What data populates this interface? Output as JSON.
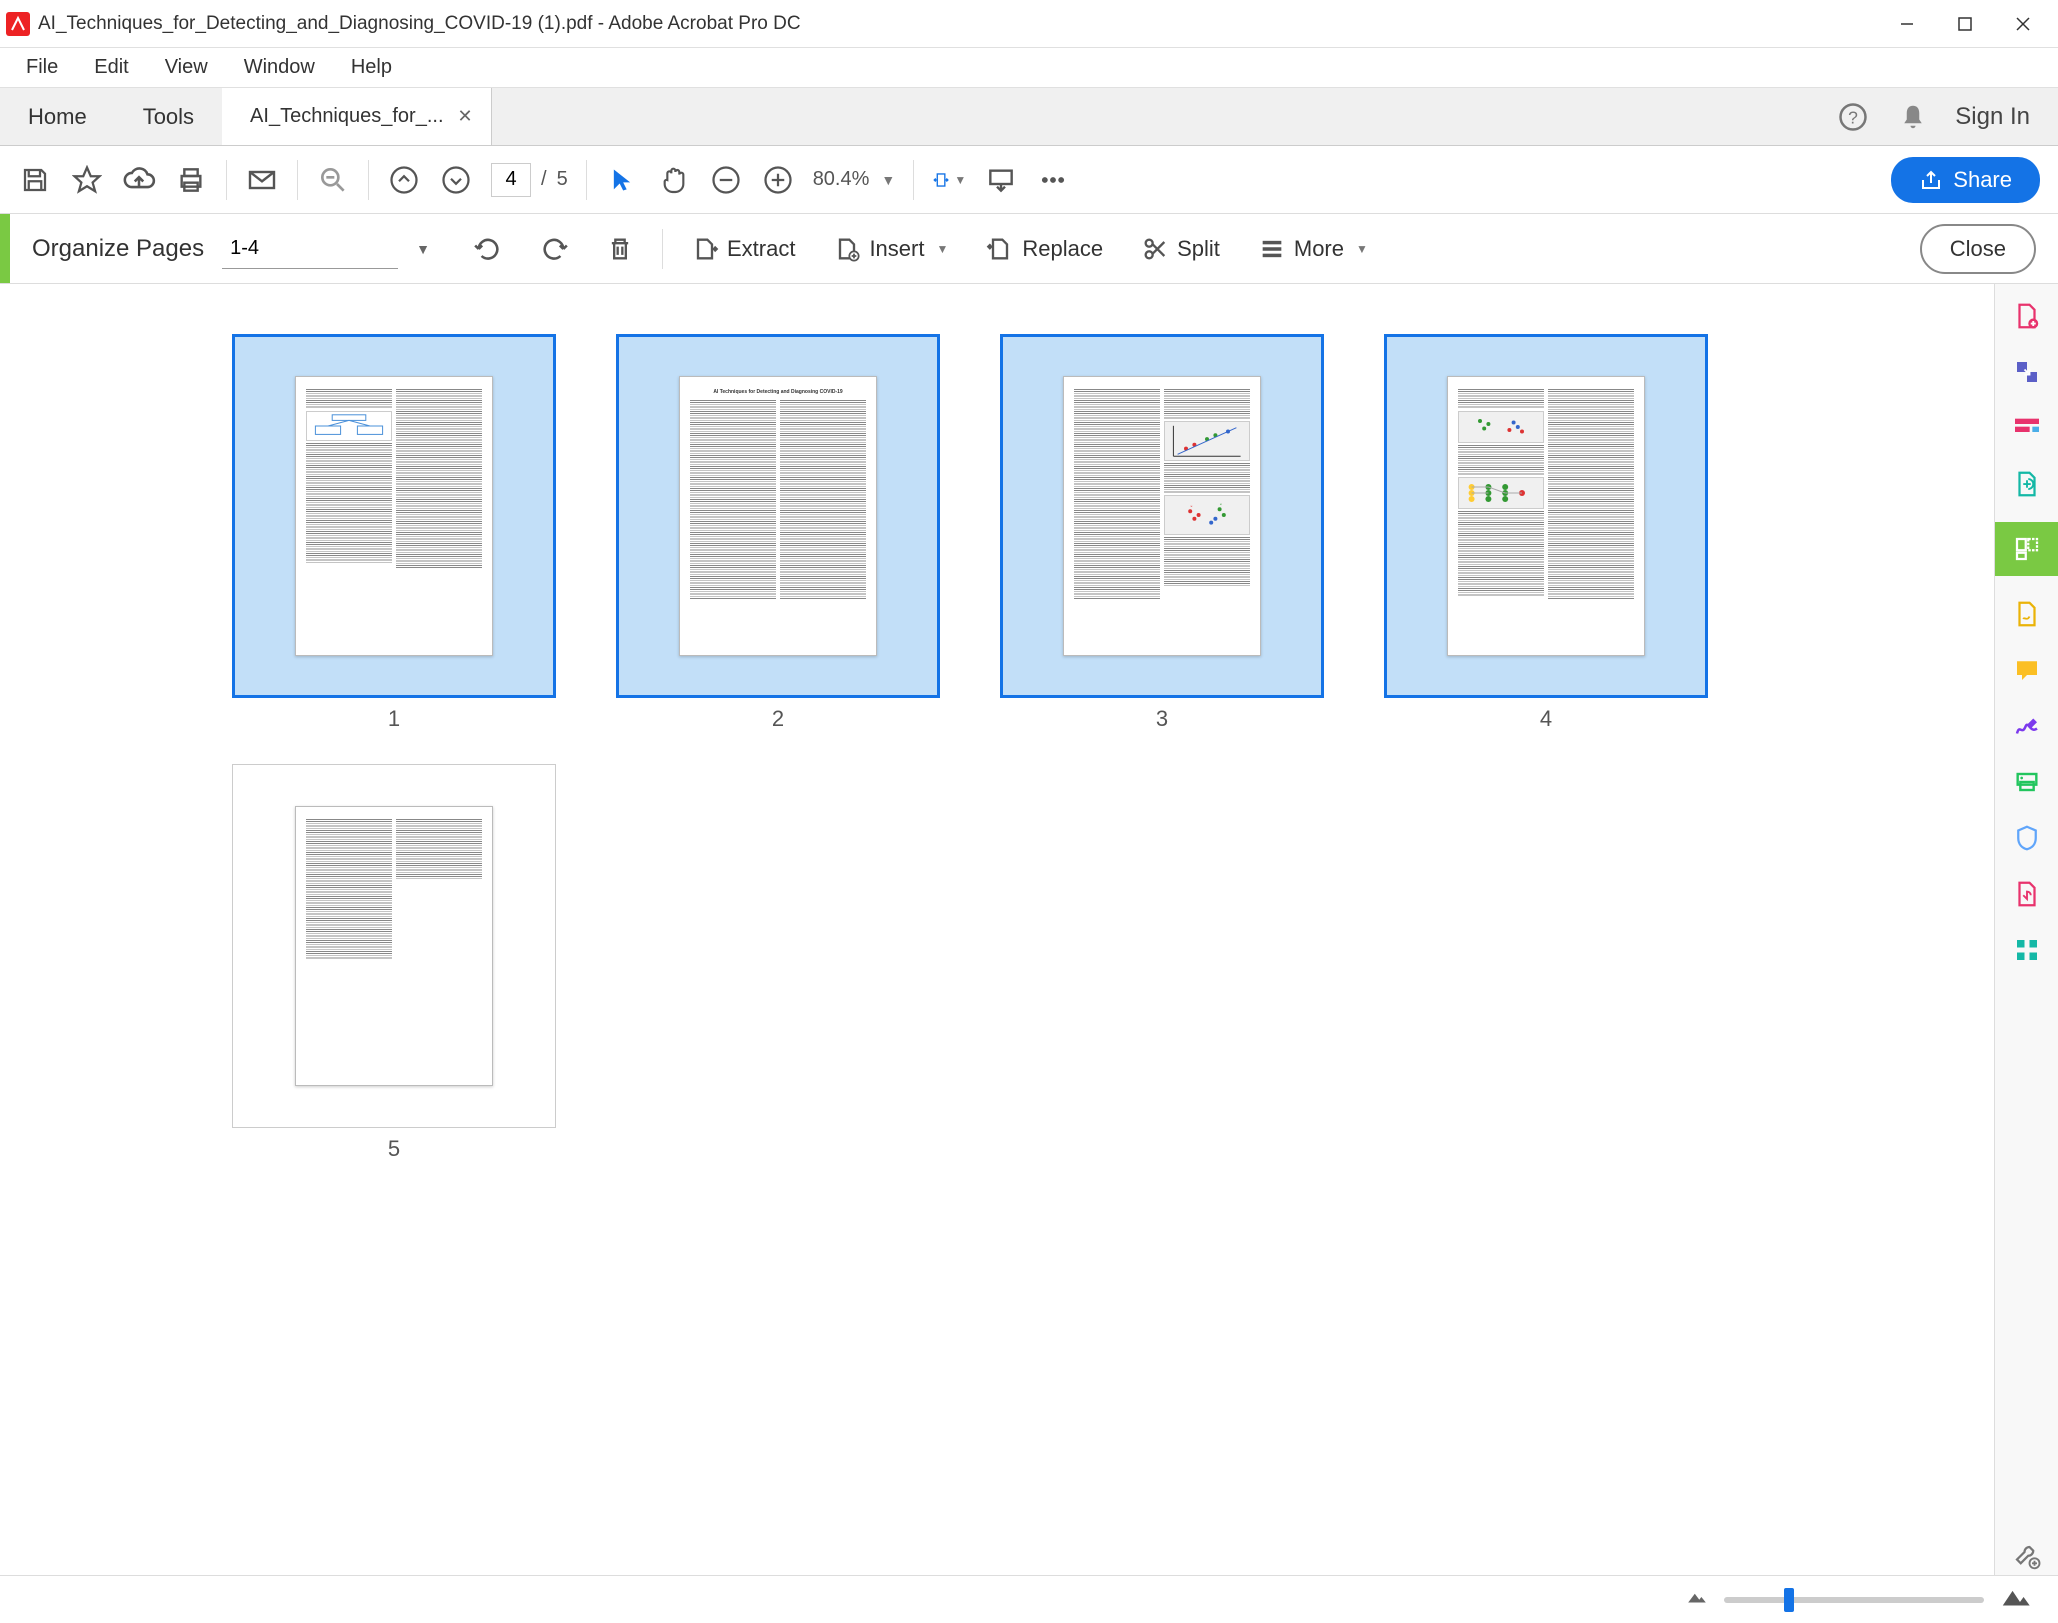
{
  "window": {
    "title": "AI_Techniques_for_Detecting_and_Diagnosing_COVID-19 (1).pdf - Adobe Acrobat Pro DC"
  },
  "menu": {
    "items": [
      "File",
      "Edit",
      "View",
      "Window",
      "Help"
    ]
  },
  "tabs": {
    "home": "Home",
    "tools": "Tools",
    "doc": "AI_Techniques_for_...",
    "signin": "Sign In"
  },
  "toolbar": {
    "page_current": "4",
    "page_sep": "/",
    "page_total": "5",
    "zoom": "80.4%",
    "share": "Share"
  },
  "organize": {
    "label": "Organize Pages",
    "range": "1-4",
    "extract": "Extract",
    "insert": "Insert",
    "replace": "Replace",
    "split": "Split",
    "more": "More",
    "close": "Close"
  },
  "pages": {
    "labels": [
      "1",
      "2",
      "3",
      "4",
      "5"
    ],
    "selected": [
      true,
      true,
      true,
      true,
      false
    ],
    "doc_title": "AI Techniques for Detecting and Diagnosing COVID-19"
  }
}
